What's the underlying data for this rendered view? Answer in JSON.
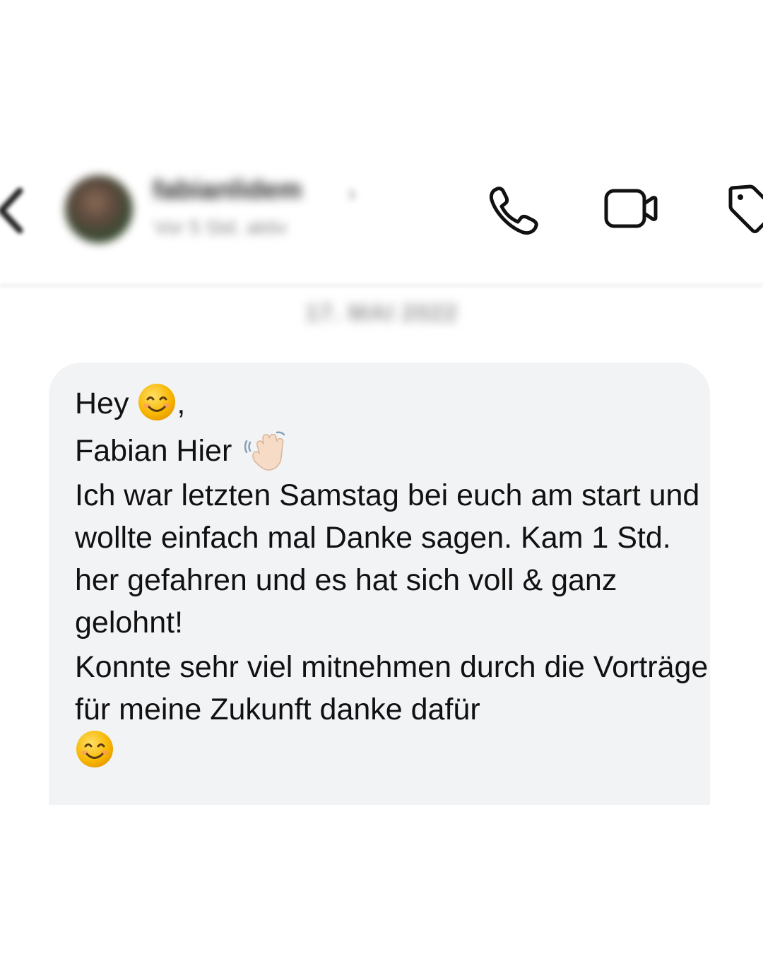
{
  "header": {
    "back_icon": "chevron-left-icon",
    "contact_name": "fabianlidem",
    "contact_chevron": "›",
    "contact_status": "Vor 5 Std. aktiv",
    "actions": [
      {
        "name": "call-button",
        "icon": "phone-icon"
      },
      {
        "name": "video-call-button",
        "icon": "video-camera-icon"
      },
      {
        "name": "tag-button",
        "icon": "tag-icon"
      }
    ]
  },
  "conversation": {
    "date_separator": "17. MAI 2022"
  },
  "message": {
    "line1_text": "Hey",
    "line1_suffix": ",",
    "line2_text": "Fabian Hier",
    "paragraph1": "Ich war letzten Samstag bei euch am start und wollte einfach mal Danke sagen. Kam 1 Std. her gefahren und es hat sich voll & ganz gelohnt!",
    "paragraph2": "Konnte sehr viel mitnehmen durch die Vorträge für meine Zukunft danke dafür",
    "emojis": [
      "smiling-face-emoji",
      "waving-hand-emoji",
      "smiling-face-emoji"
    ]
  },
  "colors": {
    "bubble_background": "#f2f3f5",
    "text": "#111111",
    "page_background": "#ffffff"
  }
}
